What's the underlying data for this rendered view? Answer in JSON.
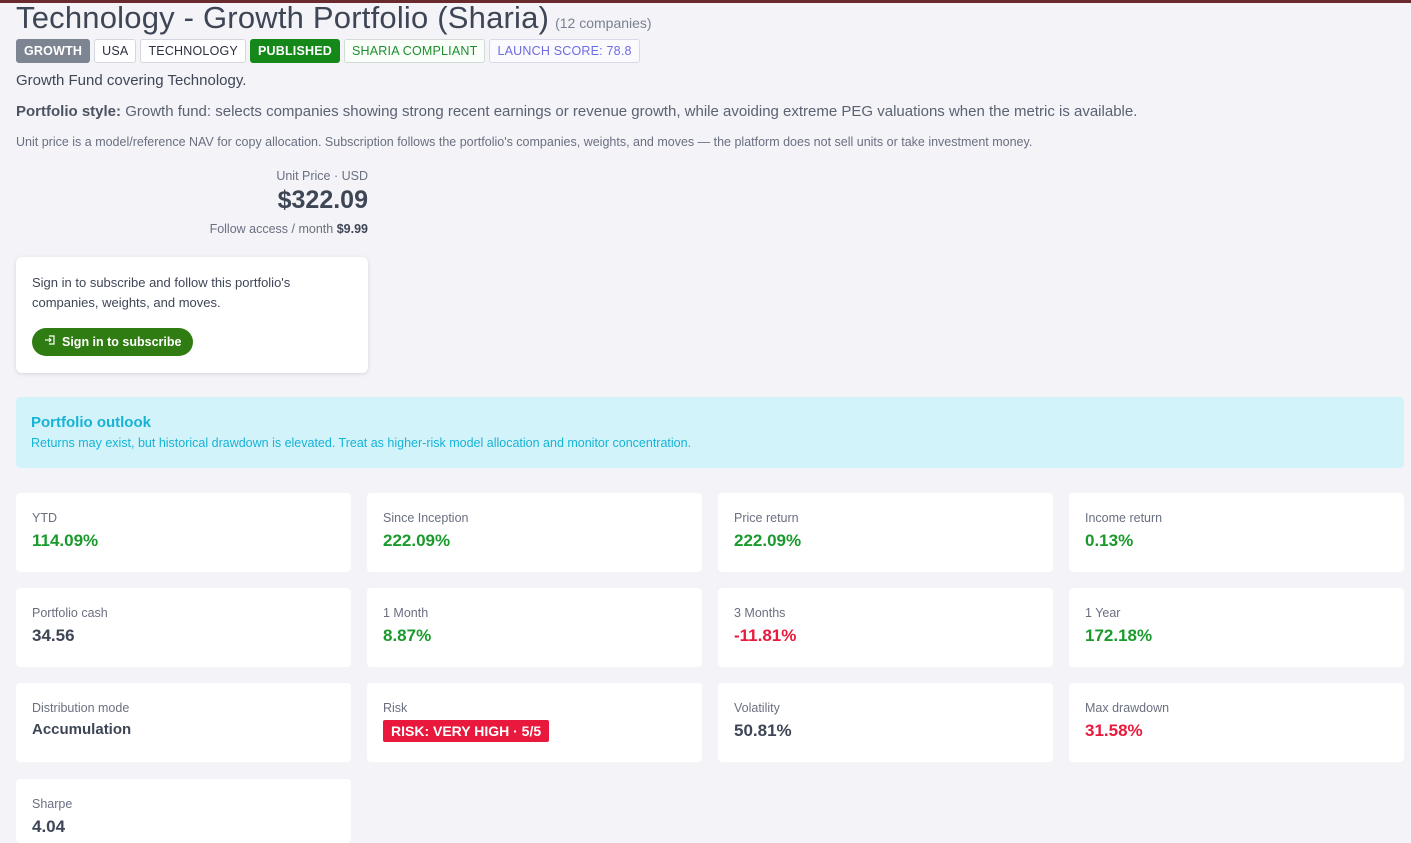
{
  "header": {
    "title": "Technology - Growth Portfolio (Sharia)",
    "company_count": "(12 companies)"
  },
  "badges": [
    {
      "label": "GROWTH",
      "kind": "growth"
    },
    {
      "label": "USA",
      "kind": "plain"
    },
    {
      "label": "TECHNOLOGY",
      "kind": "plain"
    },
    {
      "label": "PUBLISHED",
      "kind": "published"
    },
    {
      "label": "SHARIA COMPLIANT",
      "kind": "sharia"
    },
    {
      "label": "LAUNCH SCORE: 78.8",
      "kind": "score"
    }
  ],
  "description": "Growth Fund covering Technology.",
  "portfolio_style": {
    "label": "Portfolio style:",
    "text": "Growth fund: selects companies showing strong recent earnings or revenue growth, while avoiding extreme PEG valuations when the metric is available."
  },
  "note": "Unit price is a model/reference NAV for copy allocation. Subscription follows the portfolio's companies, weights, and moves — the platform does not sell units or take investment money.",
  "price": {
    "caption": "Unit Price · USD",
    "value": "$322.09",
    "follow_label": "Follow access / month",
    "follow_value": "$9.99"
  },
  "signin": {
    "text": "Sign in to subscribe and follow this portfolio's companies, weights, and moves.",
    "button_label": "Sign in to subscribe",
    "button_icon": "sign-in-icon"
  },
  "outlook": {
    "title": "Portfolio outlook",
    "text": "Returns may exist, but historical drawdown is elevated. Treat as higher-risk model allocation and monitor concentration."
  },
  "stats": {
    "ytd": {
      "label": "YTD",
      "value": "114.09%"
    },
    "since_inception": {
      "label": "Since Inception",
      "value": "222.09%"
    },
    "price_return": {
      "label": "Price return",
      "value": "222.09%"
    },
    "income_return": {
      "label": "Income return",
      "value": "0.13%"
    },
    "portfolio_cash": {
      "label": "Portfolio cash",
      "value": "34.56"
    },
    "one_month": {
      "label": "1 Month",
      "value": "8.87%"
    },
    "three_months": {
      "label": "3 Months",
      "value": "-11.81%"
    },
    "one_year": {
      "label": "1 Year",
      "value": "172.18%"
    },
    "distribution_mode": {
      "label": "Distribution mode",
      "value": "Accumulation"
    },
    "risk": {
      "label": "Risk",
      "value": "RISK: VERY HIGH · 5/5"
    },
    "volatility": {
      "label": "Volatility",
      "value": "50.81%"
    },
    "max_drawdown": {
      "label": "Max drawdown",
      "value": "31.58%"
    },
    "sharpe": {
      "label": "Sharpe",
      "value": "4.04"
    }
  },
  "colors": {
    "positive": "#1a9a2c",
    "negative": "#e8193c",
    "outlook_text": "#16b3d4",
    "outlook_bg": "#d3f3fb",
    "signin_button": "#2f7d12"
  }
}
